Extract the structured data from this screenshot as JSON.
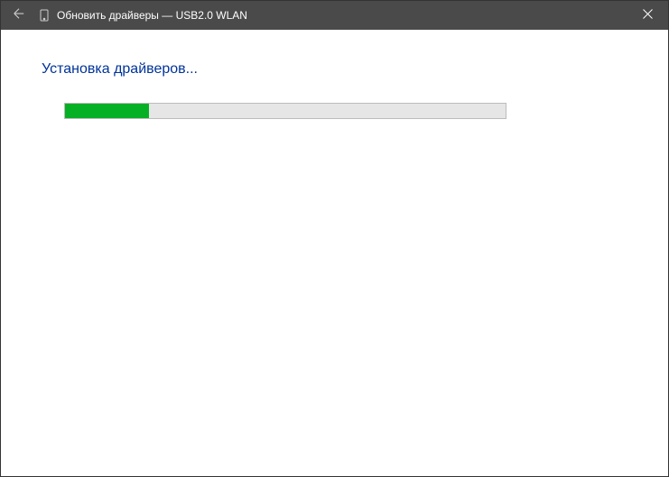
{
  "titlebar": {
    "title": "Обновить драйверы — USB2.0 WLAN"
  },
  "content": {
    "status": "Установка драйверов...",
    "progress_percent": 19
  }
}
